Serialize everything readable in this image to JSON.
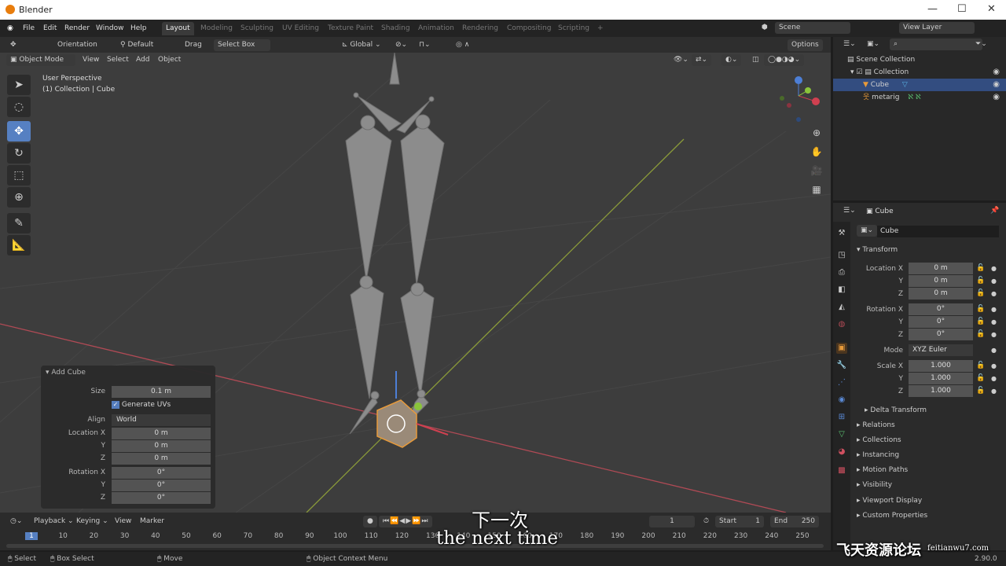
{
  "window": {
    "title": "Blender",
    "controls": [
      "—",
      "☐",
      "✕"
    ]
  },
  "menu": [
    "File",
    "Edit",
    "Render",
    "Window",
    "Help"
  ],
  "workspaces": [
    "Layout",
    "Modeling",
    "Sculpting",
    "UV Editing",
    "Texture Paint",
    "Shading",
    "Animation",
    "Rendering",
    "Compositing",
    "Scripting",
    "+"
  ],
  "scene": {
    "label": "Scene",
    "view_layer": "View Layer"
  },
  "tool_header": {
    "orientation": "Orientation",
    "default": "Default",
    "drag": "Drag",
    "select_box": "Select Box",
    "global": "Global",
    "options": "Options"
  },
  "viewport_header": {
    "mode": "Object Mode",
    "menus": [
      "View",
      "Select",
      "Add",
      "Object"
    ]
  },
  "viewport": {
    "perspective": "User Perspective",
    "collection": "(1) Collection | Cube"
  },
  "add_cube": {
    "title": "Add Cube",
    "size_label": "Size",
    "size": "0.1 m",
    "generate_uvs": "Generate UVs",
    "generate_uvs_checked": true,
    "align_label": "Align",
    "align": "World",
    "location_label": "Location X",
    "rotation_label": "Rotation X",
    "y": "Y",
    "z": "Z",
    "loc": [
      "0 m",
      "0 m",
      "0 m"
    ],
    "rot": [
      "0°",
      "0°",
      "0°"
    ]
  },
  "outliner": {
    "items": [
      {
        "label": "Scene Collection"
      },
      {
        "label": "Collection"
      },
      {
        "label": "Cube",
        "selected": true
      },
      {
        "label": "metarig"
      }
    ]
  },
  "properties": {
    "object": "Cube",
    "name": "Cube",
    "transform": "Transform",
    "location_label": "Location X",
    "rotation_label": "Rotation X",
    "scale_label": "Scale X",
    "y": "Y",
    "z": "Z",
    "mode_label": "Mode",
    "mode": "XYZ Euler",
    "location": [
      "0 m",
      "0 m",
      "0 m"
    ],
    "rotation": [
      "0°",
      "0°",
      "0°"
    ],
    "scale": [
      "1.000",
      "1.000",
      "1.000"
    ],
    "sections": [
      "Delta Transform",
      "Relations",
      "Collections",
      "Instancing",
      "Motion Paths",
      "Visibility",
      "Viewport Display",
      "Custom Properties"
    ]
  },
  "timeline": {
    "menus": [
      "Playback",
      "Keying",
      "View",
      "Marker"
    ],
    "current_frame": "1",
    "start_label": "Start",
    "start": "1",
    "end_label": "End",
    "end": "250",
    "ticks": [
      "1",
      "10",
      "20",
      "30",
      "40",
      "50",
      "60",
      "70",
      "80",
      "90",
      "100",
      "110",
      "120",
      "130",
      "140",
      "150",
      "160",
      "170",
      "180",
      "190",
      "200",
      "210",
      "220",
      "230",
      "240",
      "250"
    ]
  },
  "status": {
    "select": "Select",
    "box_select": "Box Select",
    "move": "Move",
    "context_menu": "Object Context Menu",
    "version": "2.90.0"
  },
  "subtitle": {
    "zh": "下一次",
    "en": "the next time"
  },
  "watermark": {
    "zh": "飞天资源论坛",
    "url": "feitianwu7.com"
  },
  "colors": {
    "accent": "#5680c2",
    "selection": "#334d80",
    "object_orange": "#e87d0d"
  }
}
